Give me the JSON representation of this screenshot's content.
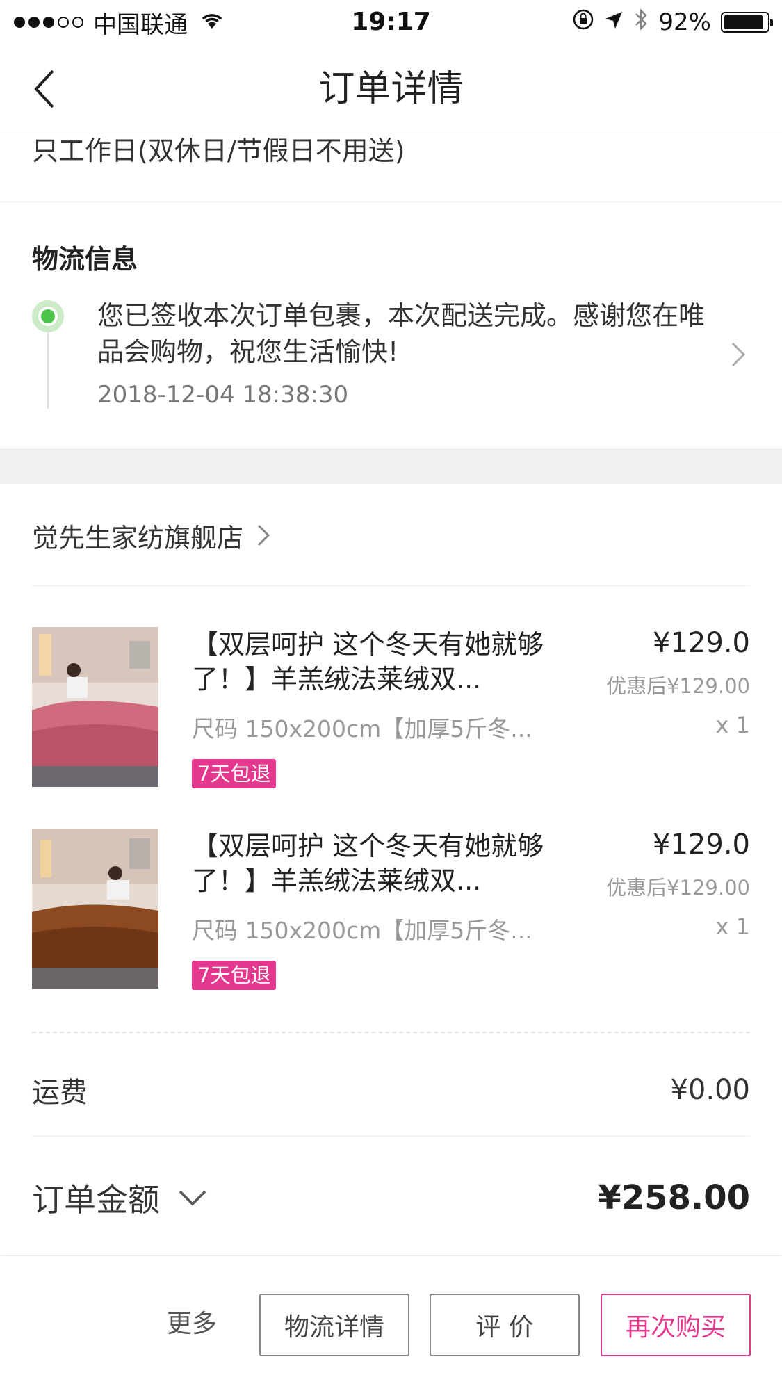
{
  "status_bar": {
    "carrier": "中国联通",
    "time": "19:17",
    "battery": "92%",
    "battery_level": 0.92,
    "signal_bars_filled": 3,
    "signal_bars_total": 5
  },
  "nav": {
    "title": "订单详情",
    "back_icon": "chevron-left-icon"
  },
  "delivery": {
    "note": "只工作日(双休日/节假日不用送)"
  },
  "logistics": {
    "title": "物流信息",
    "message": "您已签收本次订单包裹，本次配送完成。感谢您在唯品会购物，祝您生活愉快!",
    "time": "2018-12-04 18:38:30",
    "status_color": "#4cc44a"
  },
  "store": {
    "name": "觉先生家纺旗舰店"
  },
  "products": [
    {
      "title": "【双层呵护 这个冬天有她就够了！】羊羔绒法莱绒双...",
      "price": "¥129.0",
      "discount_price": "优惠后¥129.00",
      "spec": "尺码  150x200cm【加厚5斤冬...",
      "qty": "x 1",
      "badge": "7天包退",
      "image_color": "pink"
    },
    {
      "title": "【双层呵护 这个冬天有她就够了！】羊羔绒法莱绒双...",
      "price": "¥129.0",
      "discount_price": "优惠后¥129.00",
      "spec": "尺码  150x200cm【加厚5斤冬...",
      "qty": "x 1",
      "badge": "7天包退",
      "image_color": "brown"
    }
  ],
  "summary": {
    "shipping_label": "运费",
    "shipping_value": "¥0.00",
    "total_label": "订单金额",
    "total_value": "¥258.00"
  },
  "actions": {
    "more": "更多",
    "logistics_detail": "物流详情",
    "review": "评 价",
    "buy_again": "再次购买"
  },
  "colors": {
    "accent": "#e3388e",
    "success": "#4cc44a"
  }
}
